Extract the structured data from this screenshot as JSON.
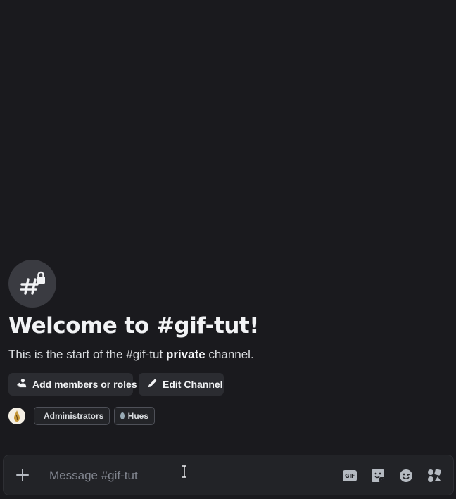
{
  "welcome": {
    "title": "Welcome to #gif-tut!",
    "subtitle_prefix": "This is the start of the #gif-tut ",
    "subtitle_bold": "private",
    "subtitle_suffix": " channel."
  },
  "actions": {
    "add_members_label": "Add members or roles",
    "edit_channel_label": "Edit Channel"
  },
  "roles": [
    {
      "name": "Administrators",
      "color": "#99aab5"
    },
    {
      "name": "Hues",
      "color": "#99aab5"
    }
  ],
  "composer": {
    "placeholder": "Message #gif-tut",
    "gif_label": "GIF"
  },
  "icons": {
    "channel": "private-text-channel-icon",
    "add_members": "add-members-icon",
    "edit": "pencil-icon",
    "upload": "plus-icon",
    "gif": "gif-icon",
    "sticker": "sticker-icon",
    "emoji": "emoji-icon",
    "apps": "apps-icon"
  }
}
